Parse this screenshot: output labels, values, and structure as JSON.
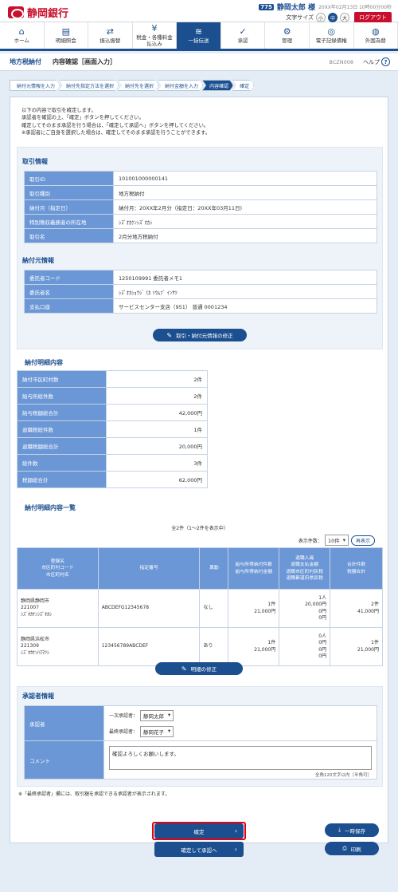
{
  "header": {
    "bank_name": "静岡銀行",
    "user_number": "775",
    "user_name": "静岡太郎 様",
    "login_time": "20XX年02月13日 10時00分00秒",
    "text_size_label": "文字サイズ",
    "text_sizes": [
      "小",
      "中",
      "大"
    ],
    "logout": "ログアウト"
  },
  "nav": [
    {
      "label": "ホーム",
      "icon": "⌂"
    },
    {
      "label": "明細照会",
      "icon": "▤"
    },
    {
      "label": "振込振替",
      "icon": "⇄"
    },
    {
      "label": "税金・各種料金\n払込み",
      "icon": "¥"
    },
    {
      "label": "一括伝送",
      "icon": "≋"
    },
    {
      "label": "承認",
      "icon": "✓"
    },
    {
      "label": "管理",
      "icon": "⚙"
    },
    {
      "label": "電子記録債権",
      "icon": "◎"
    },
    {
      "label": "外国為替",
      "icon": "◍"
    }
  ],
  "title": {
    "main": "地方税納付",
    "sub": "内容確認［画面入力］",
    "code": "BCZN008",
    "help": "ヘルプ"
  },
  "steps": [
    "納付元情報を入力",
    "納付先指定方法を選択",
    "納付先を選択",
    "納付金額を入力",
    "内容確認",
    "確定"
  ],
  "intro": [
    "以下の内容で取引を確定します。",
    "承認者を確認の上、「確定」ボタンを押してください。",
    "確定してそのまま承認を行う場合は、「確定して承認へ」ボタンを押してください。",
    "※承認者にご自身を選択した場合は、確定してそのまま承認を行うことができます。"
  ],
  "transaction": {
    "title": "取引情報",
    "rows": [
      {
        "k": "取引ID",
        "v": "101001000000141"
      },
      {
        "k": "取引種別",
        "v": "地方税納付"
      },
      {
        "k": "納付月（指定日）",
        "v": "納付月：20XX年2月分（指定日：20XX年03月11日)"
      },
      {
        "k": "特別徴収義務者の所在地",
        "v": "ｼｽﾞｵｶｹﾝｼｽﾞｵｶｼ"
      },
      {
        "k": "取引名",
        "v": "2月分地方税納付"
      }
    ]
  },
  "payer": {
    "title": "納付元情報",
    "rows": [
      {
        "k": "委託者コード",
        "v": "1250109991 委託者メモ1"
      },
      {
        "k": "委託者名",
        "v": "ｼｽﾞｵｶｼｮｳｼﾞ (ｶ ｿｳﾑﾌﾞ ｲﾝｻﾂ"
      },
      {
        "k": "支払口座",
        "v": "サービスセンター支店（951） 普通 0001234"
      }
    ],
    "edit": "取引・納付元情報の修正"
  },
  "detail": {
    "title": "納付明細内容",
    "rows": [
      {
        "k": "納付市区町村数",
        "v": "2件"
      },
      {
        "k": "給与所総件数",
        "v": "2件"
      },
      {
        "k": "給与税額総合計",
        "v": "42,000円"
      },
      {
        "k": "退職税総件数",
        "v": "1件"
      },
      {
        "k": "退職税額総合計",
        "v": "20,000円"
      },
      {
        "k": "総件数",
        "v": "3件"
      },
      {
        "k": "税額総合計",
        "v": "62,000円"
      }
    ]
  },
  "list": {
    "title": "納付明細内容一覧",
    "count": "全2件（1～2件を表示中）",
    "perpage_label": "表示件数：",
    "perpage_value": "10件",
    "redisplay": "再表示",
    "headers": [
      "登録名\n市区町村コード\n市区町村名",
      "指定番号",
      "異動",
      "給与所得納付件数\n給与所得納付金額",
      "退職人員\n退職支払金額\n退職市区町村民税\n退職都道府県民税",
      "合計件数\n税額合計"
    ],
    "rows": [
      {
        "name": "静岡県静岡市\n221007\nｼｽﾞｵｶｹﾝｼｽﾞｵｶｼ",
        "num": "ABCDEFG12345678",
        "change": "なし",
        "salary": "1件\n21,000円",
        "retire": "1人\n20,000円\n0円\n0円",
        "total": "2件\n41,000円"
      },
      {
        "name": "静岡県浜松市\n221309\nｼｽﾞｵｶｹﾝﾊﾏﾏﾂｼ",
        "num": "123456789ABCDEF",
        "change": "あり",
        "salary": "1件\n21,000円",
        "retire": "0人\n0円\n0円\n0円",
        "total": "1件\n21,000円"
      }
    ],
    "edit": "明細の修正"
  },
  "approver": {
    "title": "承認者情報",
    "label": "承認者",
    "first_label": "一次承認者：",
    "first_value": "静岡太郎",
    "final_label": "最終承認者：",
    "final_value": "静岡花子",
    "comment_label": "コメント",
    "comment_value": "確認よろしくお願いします。",
    "comment_note": "全角120文字以内［半角可］"
  },
  "footnote": "※「最終承認者」欄には、取引額を承認できる承認者が表示されます。",
  "buttons": {
    "confirm": "確定",
    "confirm_approve": "確定して承認へ",
    "save": "一時保存",
    "print": "印刷"
  }
}
